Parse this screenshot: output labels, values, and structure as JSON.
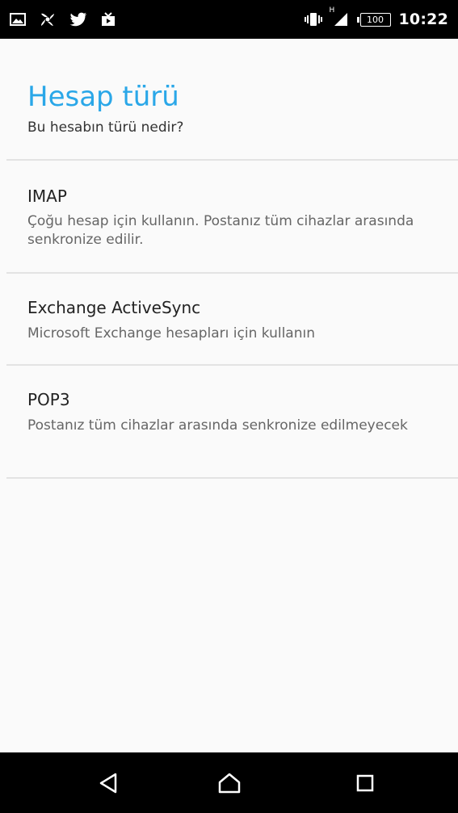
{
  "status_bar": {
    "time": "10:22",
    "battery_level": "100",
    "network_type": "H",
    "left_icons": [
      "gallery-icon",
      "pinwheel-icon",
      "twitter-icon",
      "video-icon"
    ],
    "right_icons": [
      "vibrate-icon",
      "signal-icon",
      "battery-icon"
    ]
  },
  "header": {
    "title": "Hesap türü",
    "subtitle": "Bu hesabın türü nedir?"
  },
  "options": [
    {
      "title": "IMAP",
      "description": "Çoğu hesap için kullanın. Postanız tüm cihazlar arasında senkronize edilir."
    },
    {
      "title": "Exchange ActiveSync",
      "description": "Microsoft Exchange hesapları için kullanın"
    },
    {
      "title": "POP3",
      "description": "Postanız tüm cihazlar arasında senkronize edilmeyecek"
    }
  ],
  "nav_bar": {
    "icons": [
      "back-icon",
      "home-icon",
      "recents-icon"
    ]
  },
  "colors": {
    "title": "#2aa7e8",
    "background": "#fafafa",
    "divider": "#e3e3e3"
  }
}
